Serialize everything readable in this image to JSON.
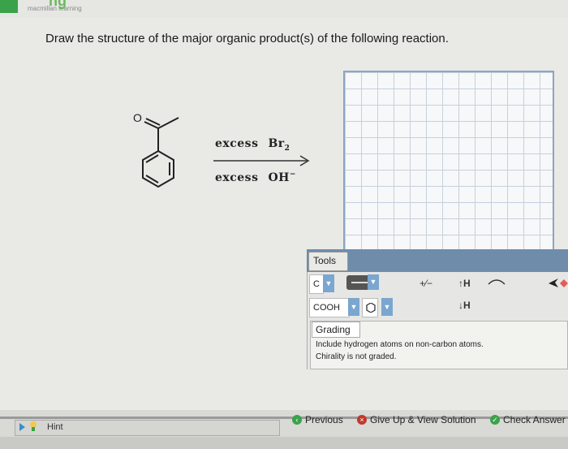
{
  "brand": {
    "name": "macmillan learning",
    "partial_title": "ng"
  },
  "question": {
    "text": "Draw the structure of the major organic product(s) of the following reaction."
  },
  "reaction": {
    "reagent1": {
      "word": "excess",
      "formula": "Br",
      "subscript": "2"
    },
    "reagent2": {
      "word": "excess",
      "formula": "OH",
      "superscript": "−"
    },
    "oxygen_label": "O"
  },
  "tools": {
    "tab_label": "Tools",
    "atom_label": "C",
    "group_label": "COOH",
    "charge_label": "+⁄−",
    "add_h_label": "↑H",
    "remove_h_label": "↓H"
  },
  "grading": {
    "tab_label": "Grading",
    "notes": [
      "Include hydrogen atoms on non-carbon atoms.",
      "Chirality is not graded."
    ]
  },
  "footer": {
    "hint_label": "Hint",
    "previous_label": "Previous",
    "give_up_label": "Give Up & View Solution",
    "check_label": "Check Answer"
  },
  "colors": {
    "accent_blue": "#7aa6cf",
    "grid_border": "#8ea4c2",
    "tools_bar": "#6f8cab",
    "check_green": "#3aa24a",
    "giveup_red": "#c0392b"
  }
}
